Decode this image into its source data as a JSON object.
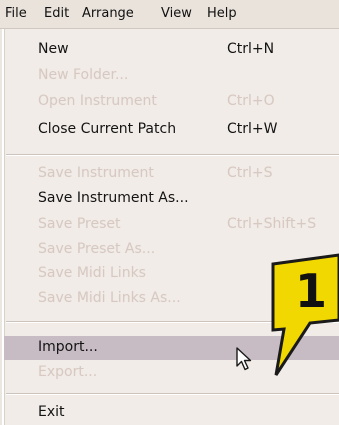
{
  "menubar": {
    "items": [
      "File",
      "Edit",
      "Arrange",
      "View",
      "Help"
    ]
  },
  "menu": {
    "new": {
      "label": "New",
      "shortcut": "Ctrl+N"
    },
    "new_folder": {
      "label": "New Folder...",
      "shortcut": ""
    },
    "open_instrument": {
      "label": "Open Instrument",
      "shortcut": "Ctrl+O"
    },
    "close_patch": {
      "label": "Close Current Patch",
      "shortcut": "Ctrl+W"
    },
    "save_instrument": {
      "label": "Save Instrument",
      "shortcut": "Ctrl+S"
    },
    "save_instrument_as": {
      "label": "Save Instrument As...",
      "shortcut": ""
    },
    "save_preset": {
      "label": "Save Preset",
      "shortcut": "Ctrl+Shift+S"
    },
    "save_preset_as": {
      "label": "Save Preset As...",
      "shortcut": ""
    },
    "save_midi_links": {
      "label": "Save Midi Links",
      "shortcut": ""
    },
    "save_midi_links_as": {
      "label": "Save Midi Links As...",
      "shortcut": ""
    },
    "import": {
      "label": "Import...",
      "shortcut": ""
    },
    "export": {
      "label": "Export...",
      "shortcut": ""
    },
    "exit": {
      "label": "Exit",
      "shortcut": ""
    }
  },
  "callout": {
    "number": "1"
  },
  "colors": {
    "callout_fill": "#f1d800",
    "callout_stroke": "#1a1a1a",
    "selected_bg": "#c8bcc4"
  }
}
